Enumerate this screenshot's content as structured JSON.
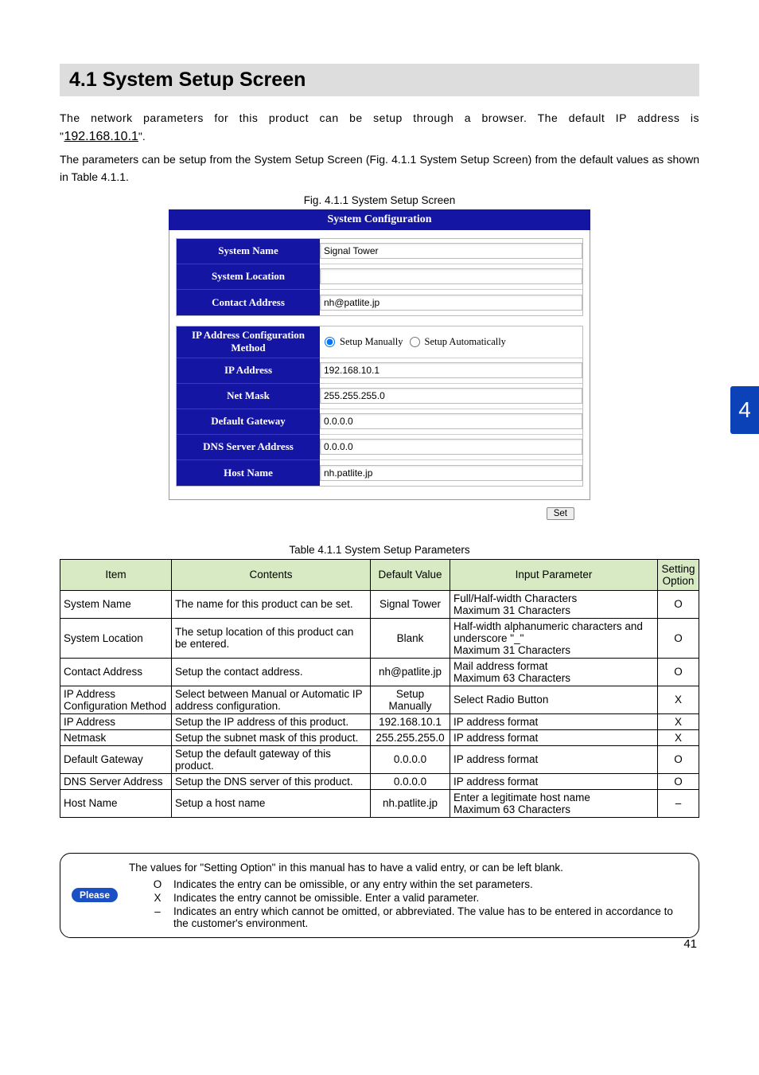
{
  "header": "4.1 System Setup Screen",
  "intro": {
    "p1a": "The network parameters for this product can be setup through a browser.  The default IP address is \"",
    "ip": "192.168.10.1",
    "p1b": "\".",
    "p2": "The parameters can be setup from the System Setup Screen (Fig. 4.1.1 System Setup Screen) from the default values as shown in Table 4.1.1."
  },
  "fig_caption": "Fig. 4.1.1 System Setup Screen",
  "sys_config_title": "System Configuration",
  "form1": [
    {
      "label": "System Name",
      "value": "Signal Tower"
    },
    {
      "label": "System Location",
      "value": ""
    },
    {
      "label": "Contact Address",
      "value": "nh@patlite.jp"
    }
  ],
  "form2_ipmethod": {
    "label": "IP Address Configuration Method",
    "opt1": "Setup Manually",
    "opt2": "Setup Automatically"
  },
  "form2": [
    {
      "label": "IP Address",
      "value": "192.168.10.1"
    },
    {
      "label": "Net Mask",
      "value": "255.255.255.0"
    },
    {
      "label": "Default Gateway",
      "value": "0.0.0.0"
    },
    {
      "label": "DNS Server Address",
      "value": "0.0.0.0"
    },
    {
      "label": "Host Name",
      "value": "nh.patlite.jp"
    }
  ],
  "set_btn": "Set",
  "table_caption": "Table 4.1.1 System Setup Parameters",
  "cols": [
    "Item",
    "Contents",
    "Default Value",
    "Input Parameter",
    "Setting Option"
  ],
  "rows": [
    {
      "item": "System Name",
      "contents": "The name for this product can be set.",
      "default": "Signal Tower",
      "input": "Full/Half-width Characters\nMaximum 31 Characters",
      "opt": "O"
    },
    {
      "item": "System Location",
      "contents": "The setup location of this product can be entered.",
      "default": "Blank",
      "input": "Half-width alphanumeric characters and underscore \"_\"\nMaximum 31 Characters",
      "opt": "O"
    },
    {
      "item": "Contact Address",
      "contents": "Setup the contact address.",
      "default": "nh@patlite.jp",
      "input": "Mail address format\nMaximum 63 Characters",
      "opt": "O"
    },
    {
      "item": "IP Address Configuration Method",
      "contents": "Select between Manual or Automatic IP address configuration.",
      "default": "Setup Manually",
      "input": "Select Radio Button",
      "opt": "X"
    },
    {
      "item": "IP Address",
      "contents": "Setup the IP address of this product.",
      "default": "192.168.10.1",
      "input": "IP address format",
      "opt": "X"
    },
    {
      "item": "Netmask",
      "contents": "Setup the subnet mask of this product.",
      "default": "255.255.255.0",
      "input": "IP address format",
      "opt": "X"
    },
    {
      "item": "Default Gateway",
      "contents": "Setup the default gateway of this product.",
      "default": "0.0.0.0",
      "input": "IP address format",
      "opt": "O"
    },
    {
      "item": "DNS Server Address",
      "contents": "Setup the DNS server of this product.",
      "default": "0.0.0.0",
      "input": "IP address format",
      "opt": "O"
    },
    {
      "item": "Host Name",
      "contents": "Setup a host name",
      "default": "nh.patlite.jp",
      "input": "Enter a legitimate host name\nMaximum 63 Characters",
      "opt": "–"
    }
  ],
  "note": {
    "please": "Please",
    "lead": "The values for \"Setting Option\" in this manual has to have a valid entry, or can be left blank.",
    "items": [
      {
        "sym": "O",
        "text": "Indicates the entry can be omissible, or any entry within the set parameters."
      },
      {
        "sym": "X",
        "text": "Indicates the entry cannot be omissible.  Enter a valid parameter."
      },
      {
        "sym": "–",
        "text": "Indicates an entry which cannot be omitted, or abbreviated.  The value has to be entered in accordance to the customer's environment."
      }
    ]
  },
  "page_num": "41",
  "chapter_tab": "4"
}
